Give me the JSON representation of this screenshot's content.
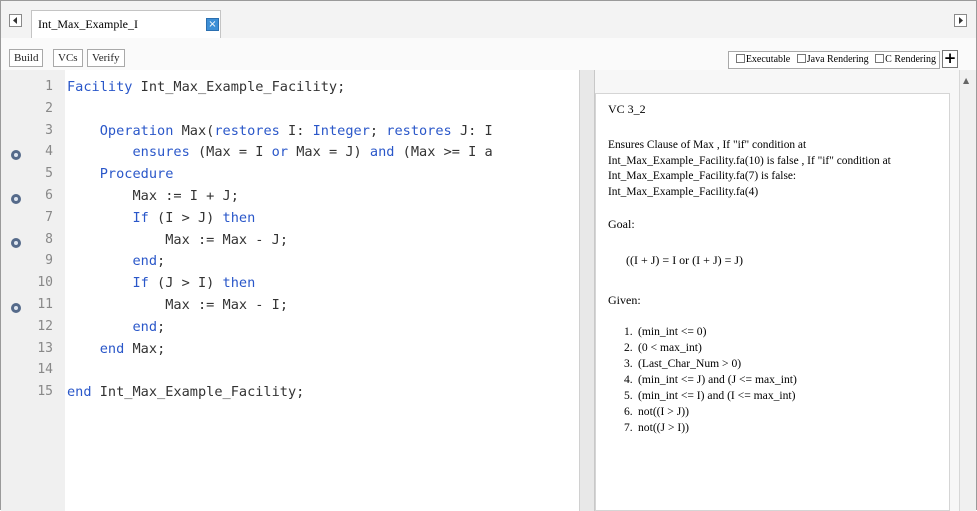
{
  "tab": {
    "title": "Int_Max_Example_I",
    "close_glyph": "×"
  },
  "toolbar": {
    "build_label": "Build",
    "vcs_label": "VCs",
    "verify_label": "Verify",
    "executable_label": "Executable",
    "java_label": "Java Rendering",
    "c_label": "C Rendering",
    "plus_label": "+"
  },
  "editor": {
    "lines": [
      {
        "num": "1",
        "text": "Facility Int_Max_Example_Facility;"
      },
      {
        "num": "2",
        "text": ""
      },
      {
        "num": "3",
        "text": "    Operation Max(restores I: Integer; restores J: I"
      },
      {
        "num": "4",
        "text": "        ensures (Max = I or Max = J) and (Max >= I a"
      },
      {
        "num": "5",
        "text": "    Procedure"
      },
      {
        "num": "6",
        "text": "        Max := I + J;"
      },
      {
        "num": "7",
        "text": "        If (I > J) then"
      },
      {
        "num": "8",
        "text": "            Max := Max - J;"
      },
      {
        "num": "9",
        "text": "        end;"
      },
      {
        "num": "10",
        "text": "        If (J > I) then"
      },
      {
        "num": "11",
        "text": "            Max := Max - I;"
      },
      {
        "num": "12",
        "text": "        end;"
      },
      {
        "num": "13",
        "text": "    end Max;"
      },
      {
        "num": "14",
        "text": ""
      },
      {
        "num": "15",
        "text": "end Int_Max_Example_Facility;"
      }
    ],
    "vc_marker_lines": [
      "4",
      "6",
      "8",
      "11"
    ]
  },
  "vc": {
    "title": "VC 3_2",
    "description": "Ensures Clause of Max , If \"if\" condition at Int_Max_Example_Facility.fa(10) is false , If \"if\" condition at Int_Max_Example_Facility.fa(7) is false: Int_Max_Example_Facility.fa(4)",
    "goal_heading": "Goal:",
    "goal": "((I + J) = I or (I + J) = J)",
    "given_heading": "Given:",
    "givens": [
      {
        "num": "1.",
        "text": "(min_int <= 0)"
      },
      {
        "num": "2.",
        "text": "(0 < max_int)"
      },
      {
        "num": "3.",
        "text": "(Last_Char_Num > 0)"
      },
      {
        "num": "4.",
        "text": "(min_int <= J) and (J <= max_int)"
      },
      {
        "num": "5.",
        "text": "(min_int <= I) and (I <= max_int)"
      },
      {
        "num": "6.",
        "text": "not((I > J))"
      },
      {
        "num": "7.",
        "text": "not((J > I))"
      }
    ]
  }
}
